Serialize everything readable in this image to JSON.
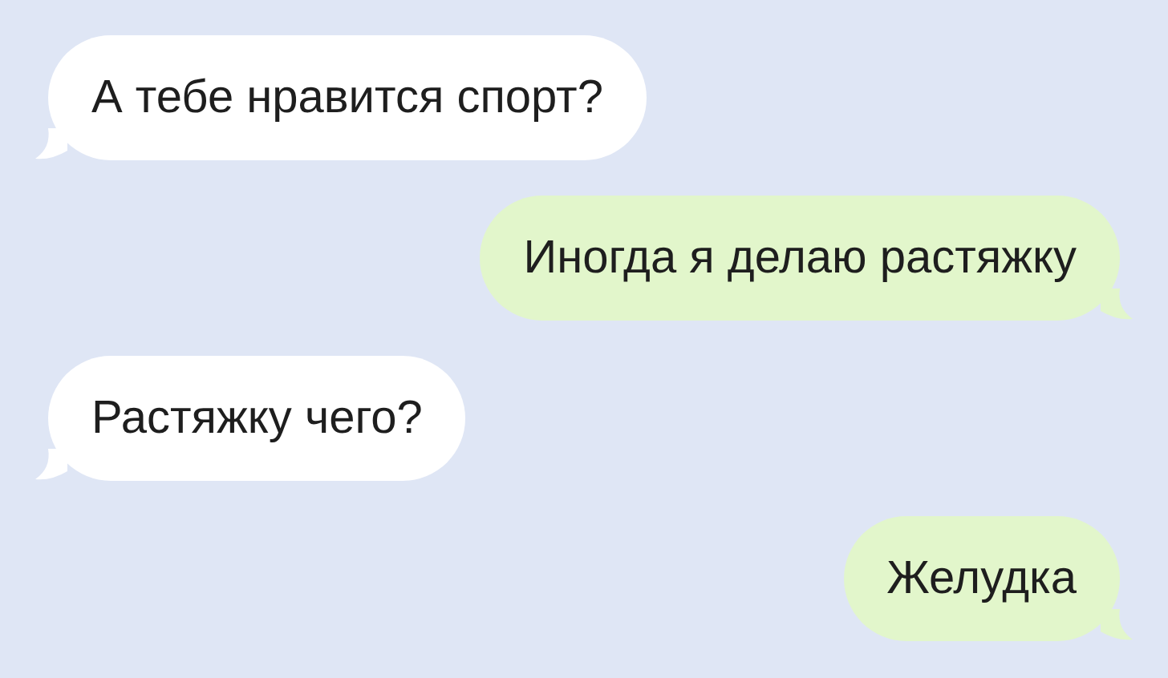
{
  "messages": [
    {
      "kind": "incoming",
      "text": "А тебе нравится спорт?"
    },
    {
      "kind": "outgoing",
      "text": "Иногда я делаю растяжку"
    },
    {
      "kind": "incoming",
      "text": "Растяжку чего?"
    },
    {
      "kind": "outgoing",
      "text": "Желудка"
    }
  ]
}
